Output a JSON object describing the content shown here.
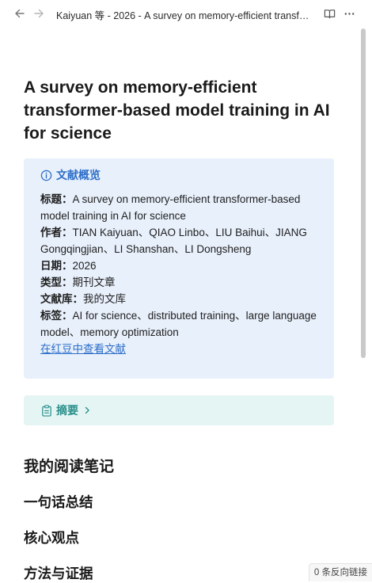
{
  "tab": {
    "title": "Kaiyuan 等 - 2026 - A survey on memory-efficient transfor..."
  },
  "icons": {
    "back": "arrow-left-icon",
    "forward": "arrow-right-icon",
    "reading_view": "book-open-icon",
    "more": "more-options-icon",
    "info": "info-circle-icon",
    "clipboard": "clipboard-icon",
    "chevron": "chevron-right-icon"
  },
  "colors": {
    "overview_bg": "#e8f0fb",
    "overview_accent": "#2f6fc9",
    "abstract_bg": "#e5f5f4",
    "abstract_accent": "#2a8f8a"
  },
  "note": {
    "title": "A survey on memory-efficient transformer-based model training in AI for science",
    "overview": {
      "heading": "文献概览",
      "title_label": "标题：",
      "title_value": "A survey on memory-efficient transformer-based model training in AI for science",
      "authors_label": "作者：",
      "authors_value": "TIAN Kaiyuan、QIAO Linbo、LIU Baihui、JIANG Gongqingjian、LI Shanshan、LI Dongsheng",
      "date_label": "日期：",
      "date_value": "2026",
      "type_label": "类型：",
      "type_value": "期刊文章",
      "library_label": "文献库：",
      "library_value": "我的文库",
      "tags_label": "标签：",
      "tags_value": "AI for science、distributed training、large language model、memory optimization",
      "link_text": "在红豆中查看文献"
    },
    "abstract_label": "摘要",
    "headings": {
      "reading_notes": "我的阅读笔记",
      "one_sentence": "一句话总结",
      "core_points": "核心观点",
      "methods": "方法与证据"
    }
  },
  "status": {
    "backlinks": "0 条反向链接"
  }
}
